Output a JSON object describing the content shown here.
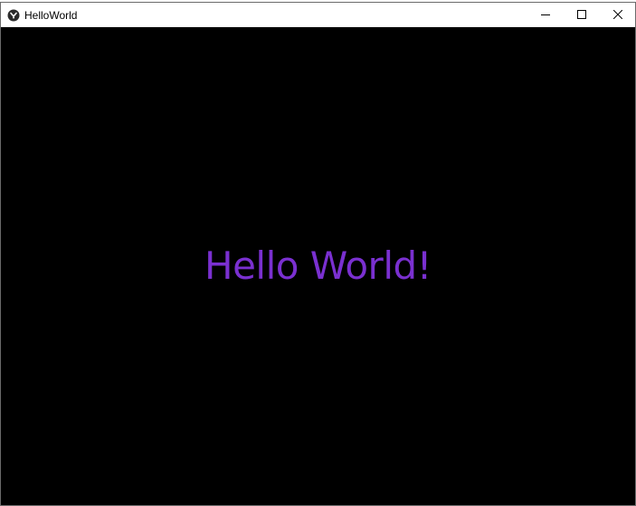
{
  "window": {
    "title": "HelloWorld",
    "app_icon": "kivy-logo-icon",
    "controls": {
      "minimize_icon": "minimize-icon",
      "maximize_icon": "maximize-icon",
      "close_icon": "close-icon"
    }
  },
  "main": {
    "label_text": "Hello World!",
    "label_color": "#7a30d0",
    "background_color": "#000000"
  }
}
